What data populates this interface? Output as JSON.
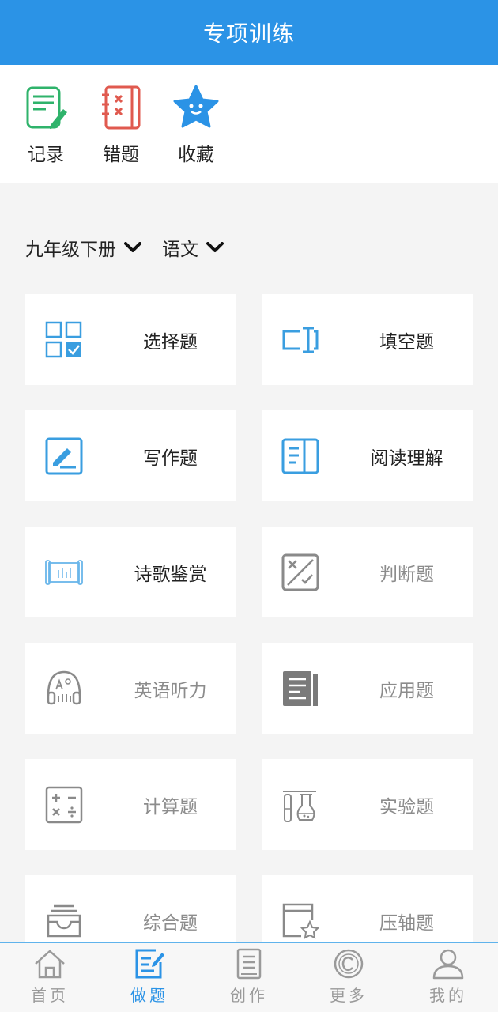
{
  "header": {
    "title": "专项训练"
  },
  "quick_links": [
    {
      "label": "记录",
      "icon": "notebook-pencil-icon"
    },
    {
      "label": "错题",
      "icon": "wrong-notebook-icon"
    },
    {
      "label": "收藏",
      "icon": "star-icon"
    }
  ],
  "filters": {
    "grade": "九年级下册",
    "subject": "语文"
  },
  "question_types": [
    {
      "label": "选择题",
      "icon": "choice-grid-icon",
      "enabled": true
    },
    {
      "label": "填空题",
      "icon": "text-cursor-icon",
      "enabled": true
    },
    {
      "label": "写作题",
      "icon": "pen-edit-icon",
      "enabled": true
    },
    {
      "label": "阅读理解",
      "icon": "open-book-icon",
      "enabled": true
    },
    {
      "label": "诗歌鉴赏",
      "icon": "scroll-icon",
      "enabled": true
    },
    {
      "label": "判断题",
      "icon": "true-false-icon",
      "enabled": false
    },
    {
      "label": "英语听力",
      "icon": "headphones-icon",
      "enabled": false
    },
    {
      "label": "应用题",
      "icon": "document-icon",
      "enabled": false
    },
    {
      "label": "计算题",
      "icon": "calculator-icon",
      "enabled": false
    },
    {
      "label": "实验题",
      "icon": "lab-flask-icon",
      "enabled": false
    },
    {
      "label": "综合题",
      "icon": "inbox-tray-icon",
      "enabled": false
    },
    {
      "label": "压轴题",
      "icon": "star-page-icon",
      "enabled": false
    }
  ],
  "tabs": [
    {
      "label": "首页",
      "icon": "home-icon"
    },
    {
      "label": "做题",
      "icon": "edit-note-icon"
    },
    {
      "label": "创作",
      "icon": "notes-icon"
    },
    {
      "label": "更多",
      "icon": "copyright-icon"
    },
    {
      "label": "我的",
      "icon": "user-icon"
    }
  ],
  "colors": {
    "primary": "#2b93e6",
    "icon_blue": "#3a9ee0",
    "icon_gray": "#8a8a8a",
    "quick_green": "#2fb36b",
    "quick_red": "#e05a4f"
  }
}
